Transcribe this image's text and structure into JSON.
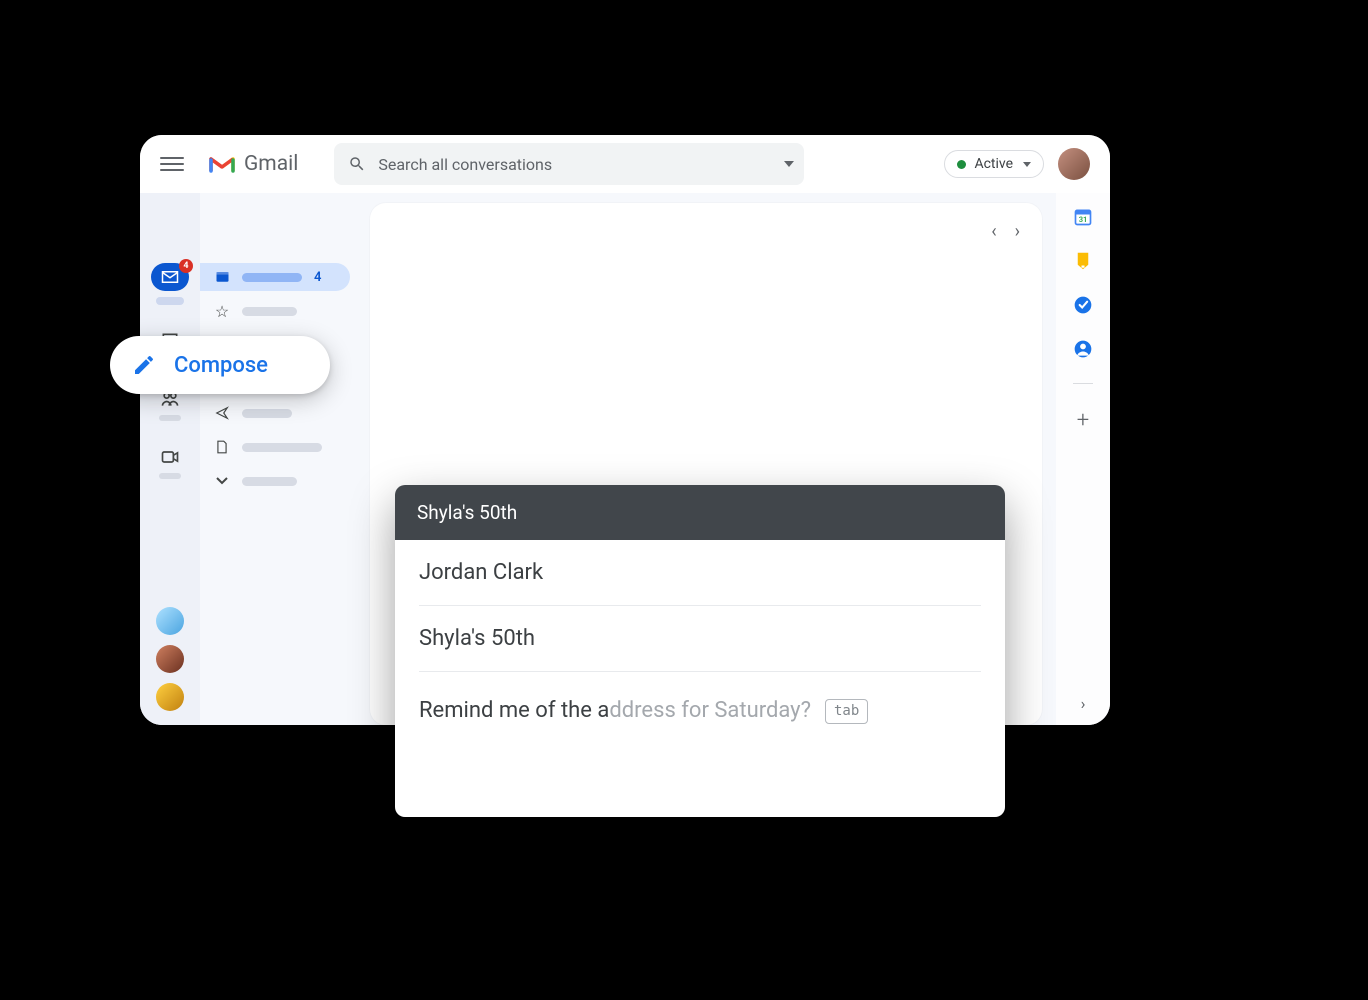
{
  "header": {
    "app_name": "Gmail",
    "search_placeholder": "Search all conversations",
    "status_label": "Active"
  },
  "compose_button": {
    "label": "Compose"
  },
  "left_rail": {
    "mail_badge": "4"
  },
  "folders": {
    "inbox_count": "4"
  },
  "compose_window": {
    "title": "Shyla's 50th",
    "recipient": "Jordan Clark",
    "subject": "Shyla's 50th",
    "body_typed": "Remind me of the a",
    "body_suggestion": "ddress for Saturday?",
    "tab_hint": "tab"
  }
}
